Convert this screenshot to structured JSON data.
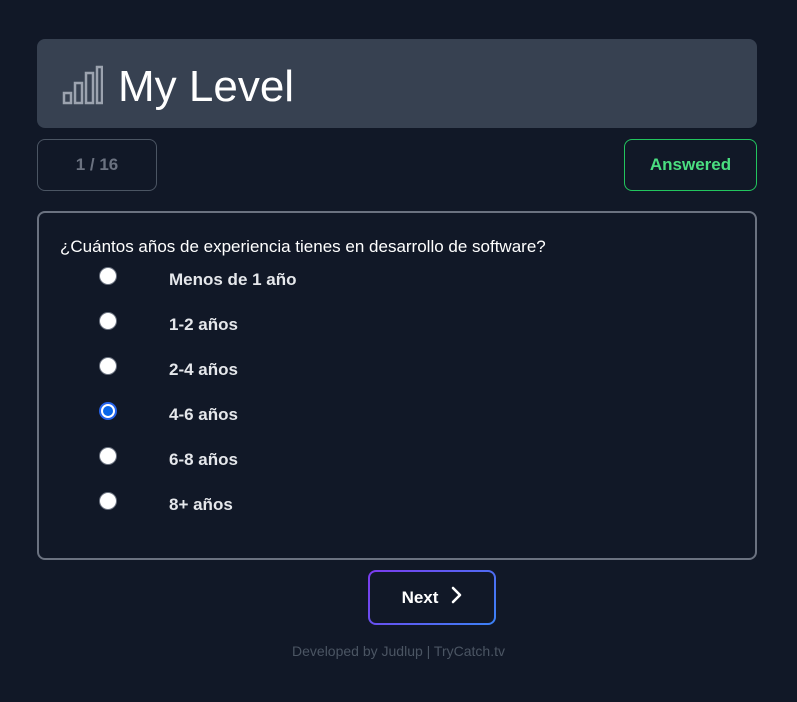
{
  "header": {
    "title": "My Level",
    "logo_icon": "bar-chart-icon"
  },
  "progress": {
    "counter": "1 / 16",
    "status": "Answered",
    "status_color": "#4ade80"
  },
  "question": {
    "text": "¿Cuántos años de experiencia tienes en desarrollo de software?",
    "options": [
      {
        "label": "Menos de 1 año",
        "selected": false
      },
      {
        "label": "1-2 años",
        "selected": false
      },
      {
        "label": "2-4 años",
        "selected": false
      },
      {
        "label": "4-6 años",
        "selected": true
      },
      {
        "label": "6-8 años",
        "selected": false
      },
      {
        "label": "8+ años",
        "selected": false
      }
    ]
  },
  "actions": {
    "next_label": "Next",
    "next_icon": "chevron-right-icon"
  },
  "footer": {
    "text": "Developed by Judlup | TryCatch.tv"
  },
  "colors": {
    "background": "#111827",
    "header_bg": "#374151",
    "accent_gradient_start": "#7c3aed",
    "accent_gradient_end": "#3b82f6",
    "selected_radio": "#0a66e8"
  }
}
